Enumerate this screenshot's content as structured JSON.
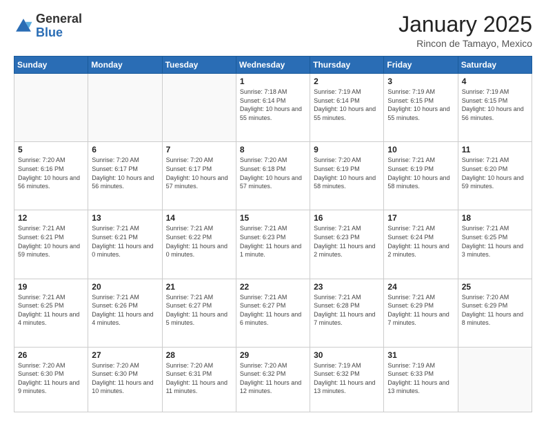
{
  "logo": {
    "general": "General",
    "blue": "Blue"
  },
  "header": {
    "month": "January 2025",
    "location": "Rincon de Tamayo, Mexico"
  },
  "weekdays": [
    "Sunday",
    "Monday",
    "Tuesday",
    "Wednesday",
    "Thursday",
    "Friday",
    "Saturday"
  ],
  "weeks": [
    [
      {
        "day": "",
        "info": ""
      },
      {
        "day": "",
        "info": ""
      },
      {
        "day": "",
        "info": ""
      },
      {
        "day": "1",
        "info": "Sunrise: 7:18 AM\nSunset: 6:14 PM\nDaylight: 10 hours and 55 minutes."
      },
      {
        "day": "2",
        "info": "Sunrise: 7:19 AM\nSunset: 6:14 PM\nDaylight: 10 hours and 55 minutes."
      },
      {
        "day": "3",
        "info": "Sunrise: 7:19 AM\nSunset: 6:15 PM\nDaylight: 10 hours and 55 minutes."
      },
      {
        "day": "4",
        "info": "Sunrise: 7:19 AM\nSunset: 6:15 PM\nDaylight: 10 hours and 56 minutes."
      }
    ],
    [
      {
        "day": "5",
        "info": "Sunrise: 7:20 AM\nSunset: 6:16 PM\nDaylight: 10 hours and 56 minutes."
      },
      {
        "day": "6",
        "info": "Sunrise: 7:20 AM\nSunset: 6:17 PM\nDaylight: 10 hours and 56 minutes."
      },
      {
        "day": "7",
        "info": "Sunrise: 7:20 AM\nSunset: 6:17 PM\nDaylight: 10 hours and 57 minutes."
      },
      {
        "day": "8",
        "info": "Sunrise: 7:20 AM\nSunset: 6:18 PM\nDaylight: 10 hours and 57 minutes."
      },
      {
        "day": "9",
        "info": "Sunrise: 7:20 AM\nSunset: 6:19 PM\nDaylight: 10 hours and 58 minutes."
      },
      {
        "day": "10",
        "info": "Sunrise: 7:21 AM\nSunset: 6:19 PM\nDaylight: 10 hours and 58 minutes."
      },
      {
        "day": "11",
        "info": "Sunrise: 7:21 AM\nSunset: 6:20 PM\nDaylight: 10 hours and 59 minutes."
      }
    ],
    [
      {
        "day": "12",
        "info": "Sunrise: 7:21 AM\nSunset: 6:21 PM\nDaylight: 10 hours and 59 minutes."
      },
      {
        "day": "13",
        "info": "Sunrise: 7:21 AM\nSunset: 6:21 PM\nDaylight: 11 hours and 0 minutes."
      },
      {
        "day": "14",
        "info": "Sunrise: 7:21 AM\nSunset: 6:22 PM\nDaylight: 11 hours and 0 minutes."
      },
      {
        "day": "15",
        "info": "Sunrise: 7:21 AM\nSunset: 6:23 PM\nDaylight: 11 hours and 1 minute."
      },
      {
        "day": "16",
        "info": "Sunrise: 7:21 AM\nSunset: 6:23 PM\nDaylight: 11 hours and 2 minutes."
      },
      {
        "day": "17",
        "info": "Sunrise: 7:21 AM\nSunset: 6:24 PM\nDaylight: 11 hours and 2 minutes."
      },
      {
        "day": "18",
        "info": "Sunrise: 7:21 AM\nSunset: 6:25 PM\nDaylight: 11 hours and 3 minutes."
      }
    ],
    [
      {
        "day": "19",
        "info": "Sunrise: 7:21 AM\nSunset: 6:25 PM\nDaylight: 11 hours and 4 minutes."
      },
      {
        "day": "20",
        "info": "Sunrise: 7:21 AM\nSunset: 6:26 PM\nDaylight: 11 hours and 4 minutes."
      },
      {
        "day": "21",
        "info": "Sunrise: 7:21 AM\nSunset: 6:27 PM\nDaylight: 11 hours and 5 minutes."
      },
      {
        "day": "22",
        "info": "Sunrise: 7:21 AM\nSunset: 6:27 PM\nDaylight: 11 hours and 6 minutes."
      },
      {
        "day": "23",
        "info": "Sunrise: 7:21 AM\nSunset: 6:28 PM\nDaylight: 11 hours and 7 minutes."
      },
      {
        "day": "24",
        "info": "Sunrise: 7:21 AM\nSunset: 6:29 PM\nDaylight: 11 hours and 7 minutes."
      },
      {
        "day": "25",
        "info": "Sunrise: 7:20 AM\nSunset: 6:29 PM\nDaylight: 11 hours and 8 minutes."
      }
    ],
    [
      {
        "day": "26",
        "info": "Sunrise: 7:20 AM\nSunset: 6:30 PM\nDaylight: 11 hours and 9 minutes."
      },
      {
        "day": "27",
        "info": "Sunrise: 7:20 AM\nSunset: 6:30 PM\nDaylight: 11 hours and 10 minutes."
      },
      {
        "day": "28",
        "info": "Sunrise: 7:20 AM\nSunset: 6:31 PM\nDaylight: 11 hours and 11 minutes."
      },
      {
        "day": "29",
        "info": "Sunrise: 7:20 AM\nSunset: 6:32 PM\nDaylight: 11 hours and 12 minutes."
      },
      {
        "day": "30",
        "info": "Sunrise: 7:19 AM\nSunset: 6:32 PM\nDaylight: 11 hours and 13 minutes."
      },
      {
        "day": "31",
        "info": "Sunrise: 7:19 AM\nSunset: 6:33 PM\nDaylight: 11 hours and 13 minutes."
      },
      {
        "day": "",
        "info": ""
      }
    ]
  ]
}
